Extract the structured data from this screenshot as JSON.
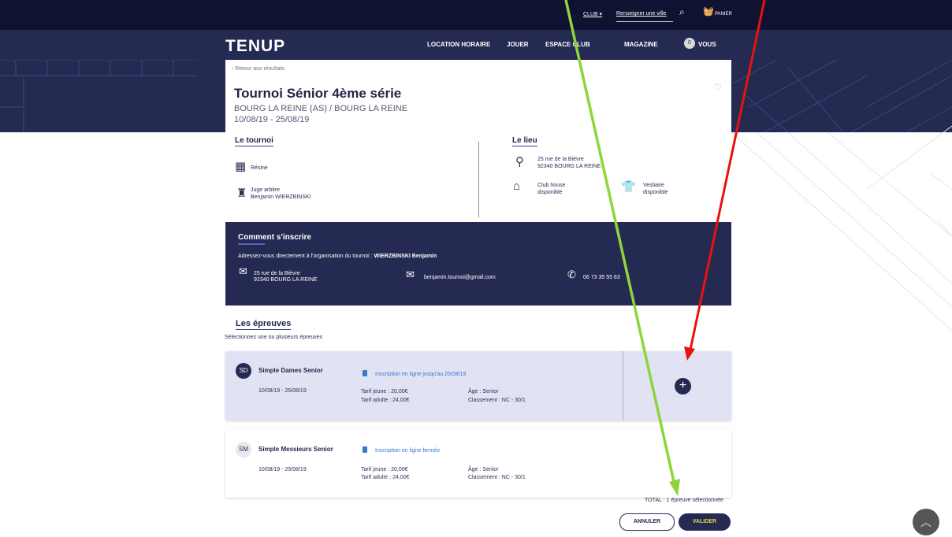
{
  "topbar": {
    "club_label": "CLUB ▾",
    "city_placeholder": "Renseigner une ville",
    "search_icon": "search-icon",
    "basket_icon": "basket-icon",
    "panier_label": "PANIER"
  },
  "nav": {
    "logo": "TENUP",
    "items": [
      "LOCATION HORAIRE",
      "JOUER",
      "ESPACE CLUB",
      "MAGAZINE"
    ],
    "vous_count": "0",
    "vous_label": "VOUS"
  },
  "tournament": {
    "back_label": "‹  Retour aux résultats",
    "title": "Tournoi Sénior 4ème série",
    "location": "BOURG LA REINE (AS) / BOURG LA REINE",
    "dates": "10/08/19 - 25/08/19",
    "section_tournoi": "Le tournoi",
    "surface": "Résine",
    "referee_label": "Juge arbitre",
    "referee_name": "Benjamin WIERZBINSKI",
    "section_lieu": "Le lieu",
    "address_line1": "25 rue de la Bièvre",
    "address_line2": "92340 BOURG LA REINE",
    "clubhouse_line1": "Club house",
    "clubhouse_line2": "disponible",
    "vestiaire_line1": "Vestiaire",
    "vestiaire_line2": "disponible"
  },
  "register": {
    "title": "Comment s'inscrire",
    "text_prefix": "Adressez-vous directement à l'organisation du tournoi : ",
    "organizer": "WIERZBINSKI Benjamin",
    "address_line1": "25 rue de la Bièvre",
    "address_line2": "92340 BOURG LA REINE",
    "email": "benjamin.tournoi@gmail.com",
    "phone": "06 73 35 55 63"
  },
  "events": {
    "title": "Les épreuves",
    "subtitle": "Sélectionnez une ou plusieurs épreuves",
    "items": [
      {
        "badge": "SD",
        "name": "Simple Dames Senior",
        "dates": "10/08/19 - 25/08/19",
        "status": "Inscription en ligne jusqu'au 25/08/19",
        "tarif_jeune": "Tarif jeune : 20,00€",
        "tarif_adulte": "Tarif adulte : 24,00€",
        "age": "Âge : Senior",
        "classement": "Classement : NC - 30/1",
        "selected": true
      },
      {
        "badge": "SM",
        "name": "Simple Messieurs Senior",
        "dates": "10/08/19 - 25/08/19",
        "status": "Inscription en ligne fermée",
        "tarif_jeune": "Tarif jeune : 20,00€",
        "tarif_adulte": "Tarif adulte : 24,00€",
        "age": "Âge : Senior",
        "classement": "Classement : NC - 30/1",
        "selected": false
      }
    ],
    "total": "TOTAL : 1 épreuve sélectionnée",
    "cancel_label": "ANNULER",
    "validate_label": "VALIDER"
  },
  "colors": {
    "nav_dark": "#242a52",
    "top_dark": "#0f1230",
    "selected_bg": "#e1e3f4",
    "link_blue": "#3a78c8",
    "valider_text": "#e8d44a",
    "annotation_green": "#8ed53a",
    "annotation_red": "#e8120e"
  }
}
